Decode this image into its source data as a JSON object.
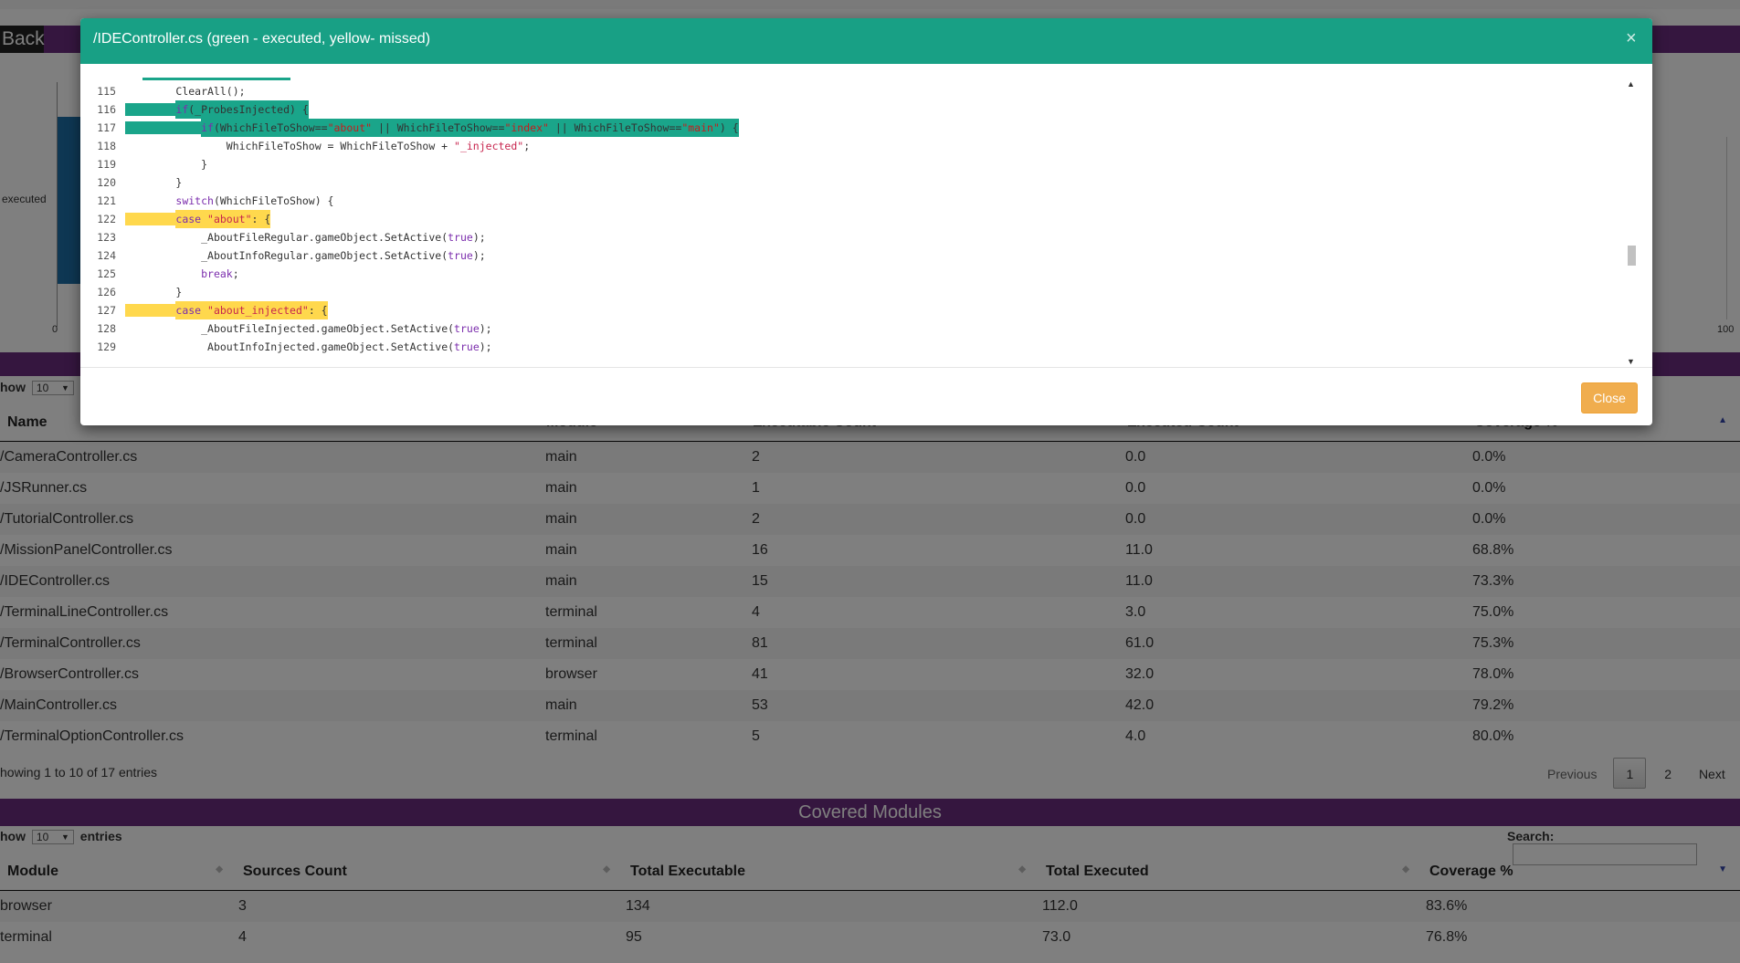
{
  "page": {
    "back_label": "Back"
  },
  "chart": {
    "y_label": "executed",
    "x_min": "0",
    "x_max": "100"
  },
  "files_table": {
    "show_label": "how",
    "length_value": "10",
    "columns": [
      "Name",
      "Module",
      "Executable Count",
      "Executed Count",
      "Coverage %"
    ],
    "rows": [
      [
        "/CameraController.cs",
        "main",
        "2",
        "0.0",
        "0.0%"
      ],
      [
        "/JSRunner.cs",
        "main",
        "1",
        "0.0",
        "0.0%"
      ],
      [
        "/TutorialController.cs",
        "main",
        "2",
        "0.0",
        "0.0%"
      ],
      [
        "/MissionPanelController.cs",
        "main",
        "16",
        "11.0",
        "68.8%"
      ],
      [
        "/IDEController.cs",
        "main",
        "15",
        "11.0",
        "73.3%"
      ],
      [
        "/TerminalLineController.cs",
        "terminal",
        "4",
        "3.0",
        "75.0%"
      ],
      [
        "/TerminalController.cs",
        "terminal",
        "81",
        "61.0",
        "75.3%"
      ],
      [
        "/BrowserController.cs",
        "browser",
        "41",
        "32.0",
        "78.0%"
      ],
      [
        "/MainController.cs",
        "main",
        "53",
        "42.0",
        "79.2%"
      ],
      [
        "/TerminalOptionController.cs",
        "terminal",
        "5",
        "4.0",
        "80.0%"
      ]
    ],
    "info": "howing 1 to 10 of 17 entries",
    "pager": {
      "previous": "Previous",
      "page1": "1",
      "page2": "2",
      "next": "Next"
    }
  },
  "modules_section": {
    "title": "Covered Modules",
    "show_label": "how",
    "length_value": "10",
    "entries_label": "entries",
    "search_label": "Search:",
    "columns": [
      "Module",
      "Sources Count",
      "Total Executable",
      "Total Executed",
      "Coverage %"
    ],
    "rows": [
      [
        "browser",
        "3",
        "134",
        "112.0",
        "83.6%"
      ],
      [
        "terminal",
        "4",
        "95",
        "73.0",
        "76.8%"
      ]
    ]
  },
  "modal": {
    "title": "/IDEController.cs (green - executed, yellow- missed)",
    "close_x": "×",
    "close_label": "Close",
    "code_lines": [
      {
        "n": "115",
        "indent": "        ",
        "text": "ClearAll();",
        "hl": "none"
      },
      {
        "n": "116",
        "indent": "        ",
        "text": "if(_ProbesInjected) {",
        "hl": "green"
      },
      {
        "n": "117",
        "indent": "            ",
        "text": "if(WhichFileToShow==\"about\" || WhichFileToShow==\"index\" || WhichFileToShow==\"main\") {",
        "hl": "green"
      },
      {
        "n": "118",
        "indent": "                ",
        "text": "WhichFileToShow = WhichFileToShow + \"_injected\";",
        "hl": "none"
      },
      {
        "n": "119",
        "indent": "            ",
        "text": "}",
        "hl": "none"
      },
      {
        "n": "120",
        "indent": "        ",
        "text": "}",
        "hl": "none"
      },
      {
        "n": "121",
        "indent": "        ",
        "text": "switch(WhichFileToShow) {",
        "hl": "none"
      },
      {
        "n": "122",
        "indent": "        ",
        "text": "case \"about\": {",
        "hl": "yellow"
      },
      {
        "n": "123",
        "indent": "            ",
        "text": "_AboutFileRegular.gameObject.SetActive(true);",
        "hl": "none"
      },
      {
        "n": "124",
        "indent": "            ",
        "text": "_AboutInfoRegular.gameObject.SetActive(true);",
        "hl": "none"
      },
      {
        "n": "125",
        "indent": "            ",
        "text": "break;",
        "hl": "none"
      },
      {
        "n": "126",
        "indent": "        ",
        "text": "}",
        "hl": "none"
      },
      {
        "n": "127",
        "indent": "        ",
        "text": "case \"about_injected\": {",
        "hl": "yellow"
      },
      {
        "n": "128",
        "indent": "            ",
        "text": "_AboutFileInjected.gameObject.SetActive(true);",
        "hl": "none"
      },
      {
        "n": "129",
        "indent": "             ",
        "text": "AboutInfoInjected.gameObject.SetActive(true);",
        "hl": "none"
      }
    ]
  },
  "colors": {
    "header_green": "#18a085",
    "executed_green": "#1aa58a",
    "missed_yellow": "#ffd84d",
    "section_purple": "#6b2d7f",
    "close_orange": "#f0ad4e"
  }
}
